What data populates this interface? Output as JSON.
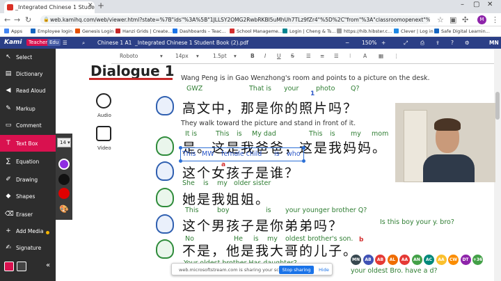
{
  "browser": {
    "tab_title": "_Integrated Chinese 1 Student B",
    "url": "web.kamihq.com/web/viewer.html?state=%7B\"ids\"%3A%5B\"1JLLSY2OMG2RwbRKBI5uMhUh7TLz9fZr4\"%5D%2C\"from\"%3A\"classroomopenext\"%2C\"aut...",
    "avatar_letter": "M",
    "bookmarks": [
      "Apps",
      "Employee login",
      "Genesis Login",
      "Hanzi Grids | Create...",
      "Dashboards – Teac...",
      "School Manageme...",
      "Login | Cheng & Ts...",
      "https://hib.hibster.c...",
      "Clever | Log in",
      "Safe Digital Learnin..."
    ]
  },
  "kami": {
    "logo": "Kami",
    "role_teacher": "Teacher",
    "role_edu": "Edu",
    "doc_class": "Chinese 1 A1",
    "doc_name": "_Integrated Chinese 1 Student Book (2).pdf",
    "zoom": "150%",
    "user_initials": "MN"
  },
  "format_bar": {
    "font": "Roboto",
    "size": "14px",
    "line_spacing": "1.5pt"
  },
  "sidebar": {
    "items": [
      {
        "icon": "↖",
        "label": "Select"
      },
      {
        "icon": "▤",
        "label": "Dictionary"
      },
      {
        "icon": "◀",
        "label": "Read Aloud"
      },
      {
        "icon": "✎",
        "label": "Markup"
      },
      {
        "icon": "▭",
        "label": "Comment"
      },
      {
        "icon": "T",
        "label": "Text Box"
      },
      {
        "icon": "∑",
        "label": "Equation"
      },
      {
        "icon": "✐",
        "label": "Drawing"
      },
      {
        "icon": "◆",
        "label": "Shapes"
      },
      {
        "icon": "⌫",
        "label": "Eraser"
      },
      {
        "icon": "+",
        "label": "Add Media"
      },
      {
        "icon": "✍",
        "label": "Signature"
      }
    ],
    "text_size": "14",
    "palette_colors": [
      "#8e2de2",
      "#111111",
      "#e00000"
    ]
  },
  "page": {
    "title": "Dialogue 1",
    "audio_label": "Audio",
    "video_label": "Video",
    "intro": "Wang Peng is in Gao Wenzhong's room and points to a picture on the desk.",
    "line1_gloss": [
      "GWZ",
      "That is",
      "your",
      "photo",
      "Q?"
    ],
    "line1_zh": "高文中，那是你的照片吗？",
    "stage2": "They walk toward the picture and stand in front of it.",
    "line2_gloss": [
      "It is",
      "This",
      "is",
      "My dad",
      "This",
      "is",
      "my",
      "mom"
    ],
    "line2_zh": "是。这是我爸爸，这是我妈妈。",
    "textbox": [
      "This",
      "MW",
      "female child",
      "is",
      "who"
    ],
    "line3_zh": "这个女孩子是谁？",
    "line3_gloss": [
      "She",
      "is",
      "my",
      "older sister"
    ],
    "line4_zh": "她是我姐姐。",
    "line5_gloss": [
      "This",
      "boy",
      "is",
      "your younger brother Q?"
    ],
    "line5_side": "Is this boy your y. bro?",
    "line5_zh": "这个男孩子是你弟弟吗？",
    "line6_gloss": [
      "No",
      "He",
      "is",
      "my",
      "oldest brother's son."
    ],
    "line6_zh": "不是，他是我大哥的儿子。",
    "line7_partial": "Your oldest brother Has daughter?",
    "line7_side": "your oldest Bro. have a d?",
    "marks": [
      "1",
      "a",
      "b"
    ]
  },
  "share": {
    "text": "web.microsoftstream.com is sharing your screen.",
    "stop": "Stop sharing",
    "hide": "Hide"
  },
  "collaborators": [
    {
      "initials": "MN",
      "color": "#37474f"
    },
    {
      "initials": "AB",
      "color": "#3f51b5"
    },
    {
      "initials": "AB",
      "color": "#e53935"
    },
    {
      "initials": "AL",
      "color": "#ef6c00"
    },
    {
      "initials": "AA",
      "color": "#e53935"
    },
    {
      "initials": "AN",
      "color": "#43a047"
    },
    {
      "initials": "AC",
      "color": "#00897b"
    },
    {
      "initials": "AA",
      "color": "#fbc02d"
    },
    {
      "initials": "CW",
      "color": "#fb8c00"
    },
    {
      "initials": "DT",
      "color": "#8e24aa"
    },
    {
      "initials": "+36",
      "color": "#43a047"
    }
  ]
}
